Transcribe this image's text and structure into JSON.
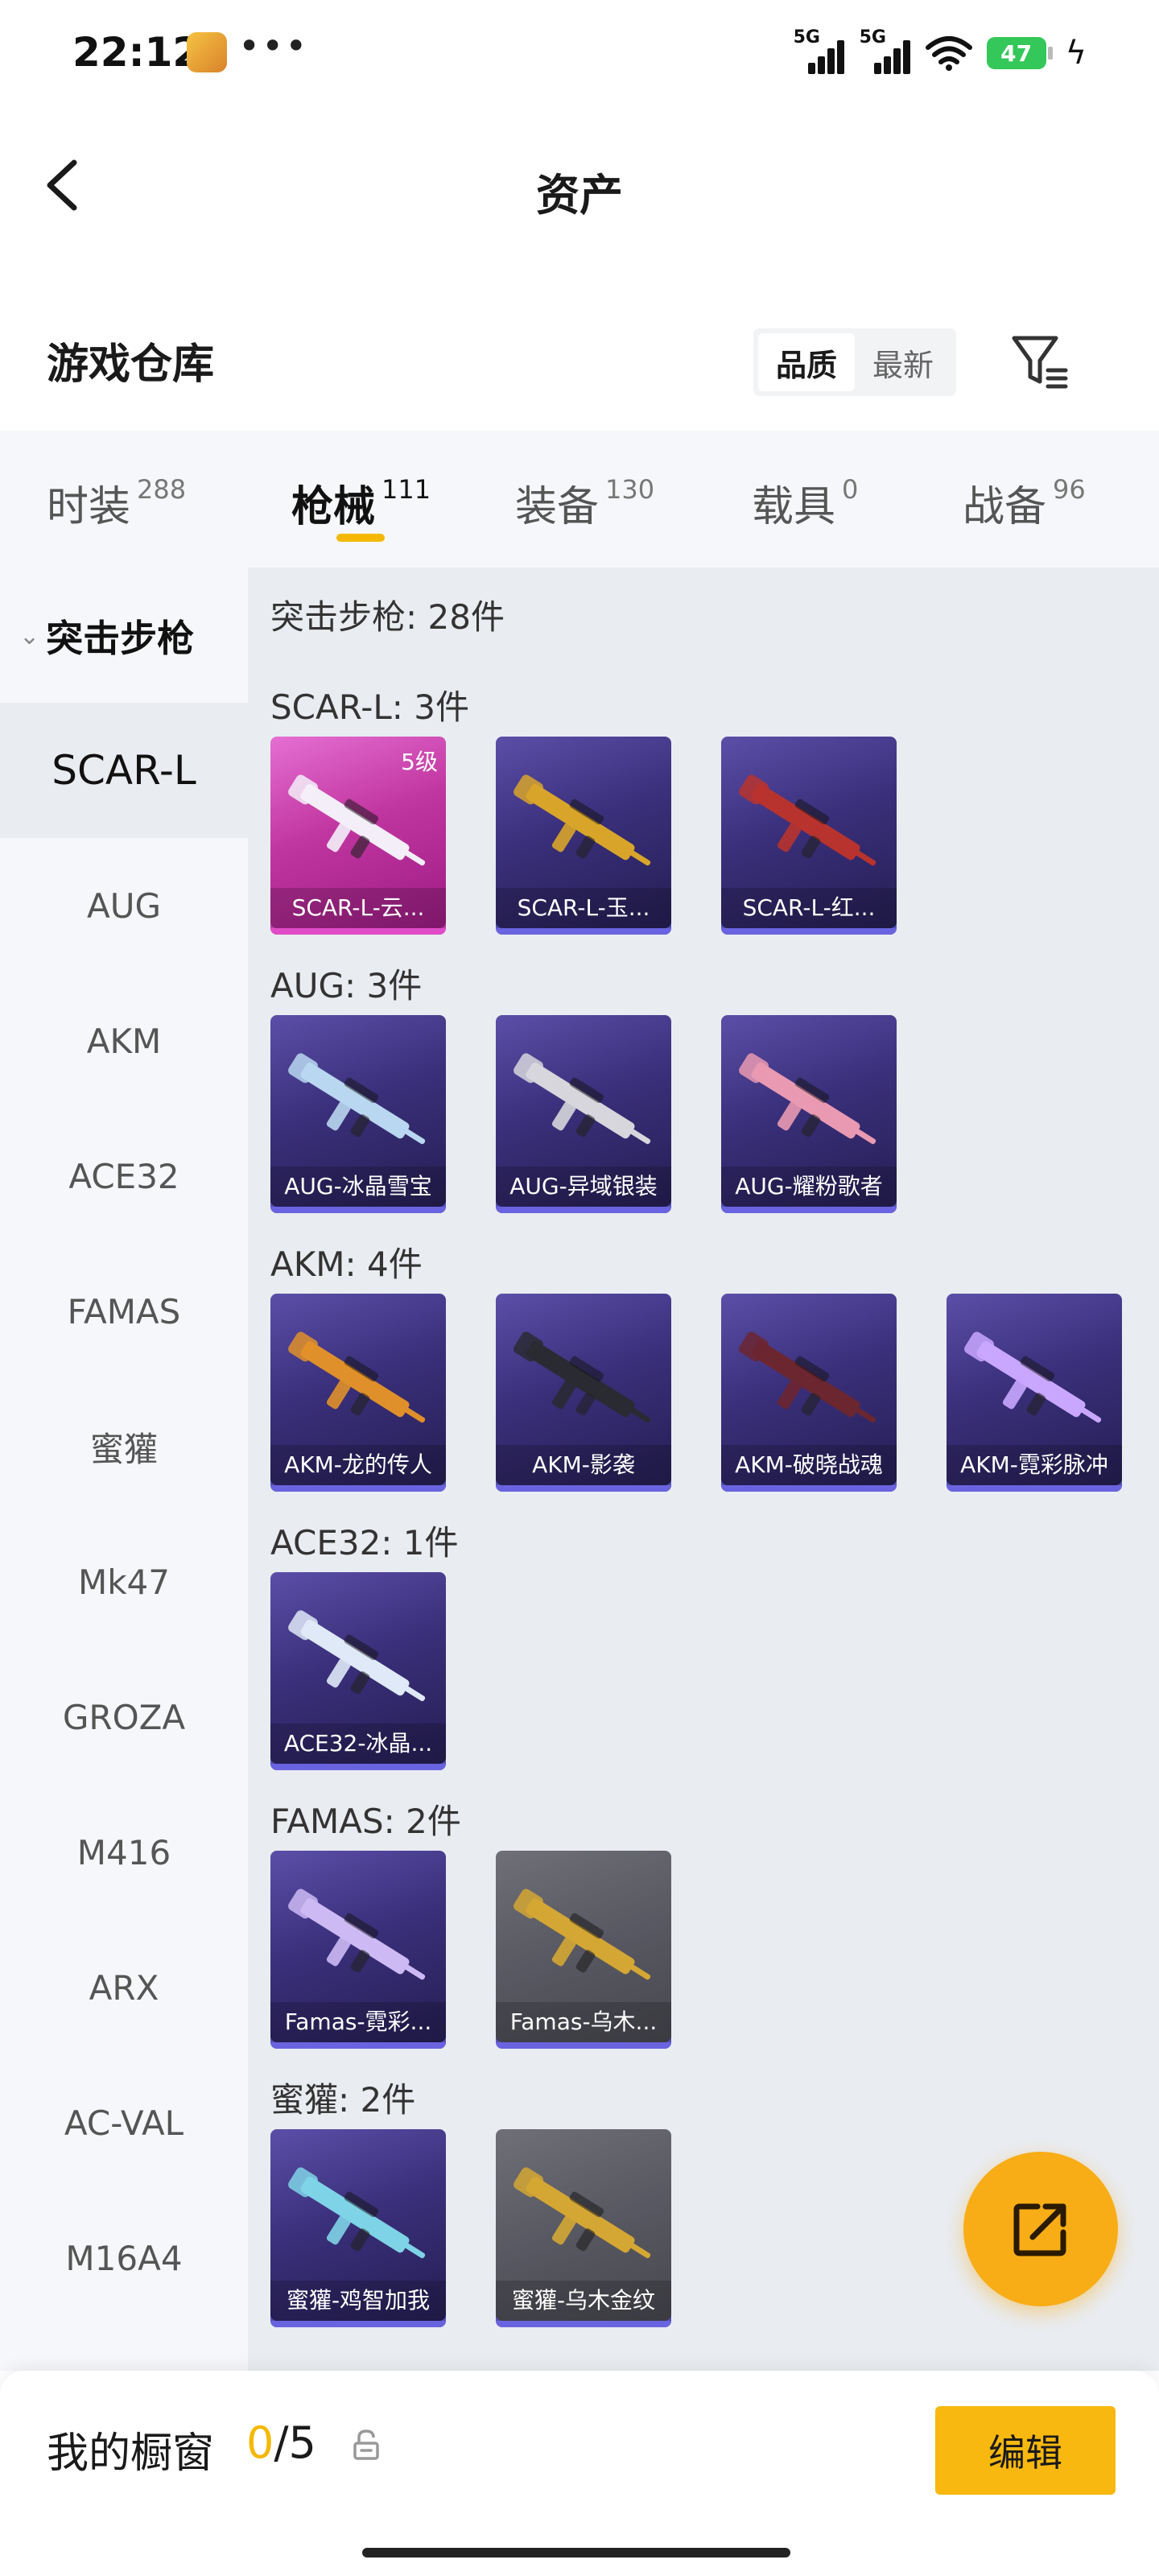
{
  "status": {
    "time": "22:12",
    "signal1": "5G",
    "signal2": "5G",
    "battery": "47",
    "dots": "•••"
  },
  "header": {
    "title": "资产"
  },
  "warehouse": {
    "title": "游戏仓库",
    "sort_options": [
      "品质",
      "最新"
    ]
  },
  "tabs": [
    {
      "label": "时装",
      "count": "288"
    },
    {
      "label": "枪械",
      "count": "111"
    },
    {
      "label": "装备",
      "count": "130"
    },
    {
      "label": "载具",
      "count": "0"
    },
    {
      "label": "战备",
      "count": "96"
    }
  ],
  "sidebar": {
    "category": "突击步枪",
    "items": [
      "SCAR-L",
      "AUG",
      "AKM",
      "ACE32",
      "FAMAS",
      "蜜獾",
      "Mk47",
      "GROZA",
      "M416",
      "ARX",
      "AC-VAL",
      "M16A4"
    ]
  },
  "content": {
    "summary": "突击步枪: 28件",
    "sections": [
      {
        "title": "SCAR-L: 3件",
        "cards": [
          {
            "name": "SCAR-L-云...",
            "level": "5级",
            "rarity": "legend",
            "gun_color": "#f3eef8"
          },
          {
            "name": "SCAR-L-玉...",
            "rarity": "epic",
            "gun_color": "#d8a52a"
          },
          {
            "name": "SCAR-L-红...",
            "rarity": "epic",
            "gun_color": "#b8332e"
          }
        ]
      },
      {
        "title": "AUG: 3件",
        "cards": [
          {
            "name": "AUG-冰晶雪宝",
            "rarity": "epic",
            "gun_color": "#b9d7f0"
          },
          {
            "name": "AUG-异域银装",
            "rarity": "epic",
            "gun_color": "#d6d6dc"
          },
          {
            "name": "AUG-耀粉歌者",
            "rarity": "epic",
            "gun_color": "#e99ab2"
          }
        ]
      },
      {
        "title": "AKM: 4件",
        "cards": [
          {
            "name": "AKM-龙的传人",
            "rarity": "epic",
            "gun_color": "#e0902a"
          },
          {
            "name": "AKM-影袭",
            "rarity": "epic",
            "gun_color": "#2a2a33"
          },
          {
            "name": "AKM-破晓战魂",
            "rarity": "epic",
            "gun_color": "#6b2630"
          },
          {
            "name": "AKM-霓彩脉冲",
            "rarity": "epic",
            "gun_color": "#c9a7ff"
          }
        ]
      },
      {
        "title": "ACE32: 1件",
        "cards": [
          {
            "name": "ACE32-冰晶...",
            "rarity": "epic",
            "gun_color": "#dfe9f7"
          }
        ]
      },
      {
        "title": "FAMAS: 2件",
        "cards": [
          {
            "name": "Famas-霓彩...",
            "rarity": "epic",
            "gun_color": "#cdbaf5"
          },
          {
            "name": "Famas-乌木...",
            "rarity": "gray",
            "gun_color": "#d4a734"
          }
        ]
      },
      {
        "title": "蜜獾: 2件",
        "cards": [
          {
            "name": "蜜獾-鸡智加我",
            "rarity": "epic",
            "gun_color": "#7fd3e6"
          },
          {
            "name": "蜜獾-乌木金纹",
            "rarity": "gray",
            "gun_color": "#d4a734"
          }
        ]
      }
    ]
  },
  "showcase": {
    "label": "我的橱窗",
    "current": "0",
    "total": "/5",
    "edit_label": "编辑"
  }
}
